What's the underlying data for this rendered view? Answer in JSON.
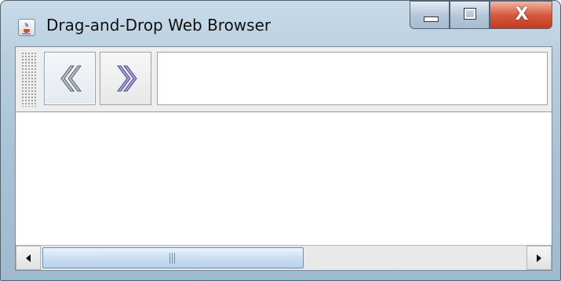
{
  "window": {
    "title": "Drag-and-Drop Web Browser",
    "app_icon": "java-cup-icon",
    "controls": {
      "minimize": "minimize-icon",
      "maximize": "maximize-icon",
      "close": "close-icon",
      "close_glyph": "X"
    }
  },
  "toolbar": {
    "back_icon": "chevron-double-left-icon",
    "forward_icon": "chevron-double-right-icon",
    "address": {
      "value": "",
      "placeholder": ""
    }
  },
  "scrollbar": {
    "left_arrow": "arrow-left-icon",
    "right_arrow": "arrow-right-icon",
    "position": 0.0
  },
  "colors": {
    "title_bar": "#b9cfe0",
    "close_button": "#d55b3e",
    "thumb": "#c9deef"
  }
}
